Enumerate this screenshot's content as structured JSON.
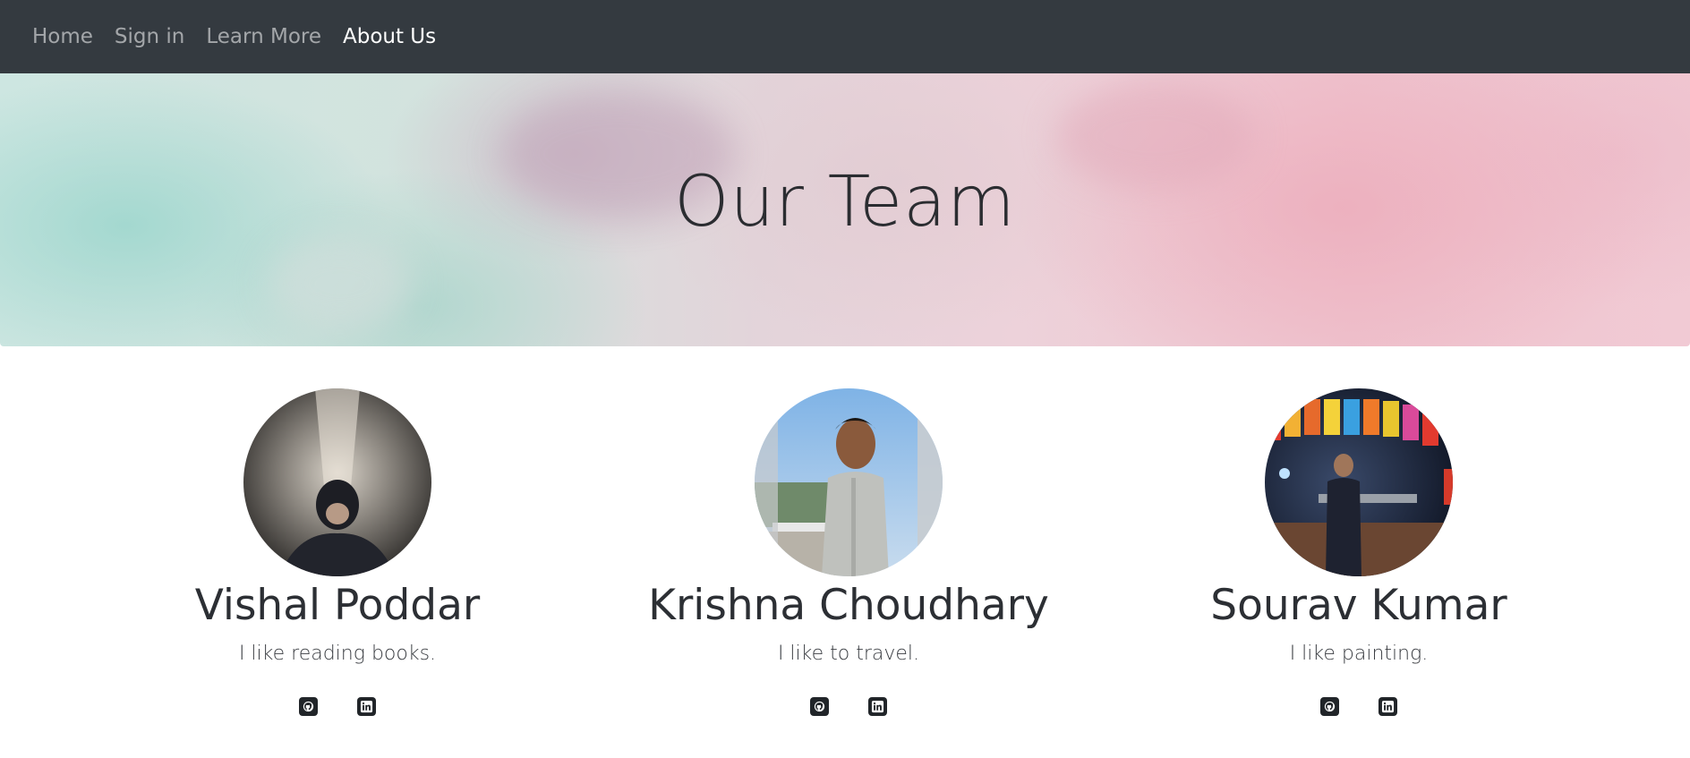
{
  "nav": {
    "items": [
      {
        "label": "Home"
      },
      {
        "label": "Sign in"
      },
      {
        "label": "Learn More"
      },
      {
        "label": "About Us"
      }
    ]
  },
  "hero": {
    "title": "Our Team"
  },
  "team": [
    {
      "name": "Vishal Poddar",
      "bio": "I like reading books."
    },
    {
      "name": "Krishna Choudhary",
      "bio": "I like to travel."
    },
    {
      "name": "Sourav Kumar",
      "bio": "I like painting."
    }
  ],
  "icons": {
    "github": "github-icon",
    "linkedin": "linkedin-icon"
  },
  "colors": {
    "navbar": "#343a40",
    "nav_active": "#ffffff",
    "text": "#212529"
  }
}
